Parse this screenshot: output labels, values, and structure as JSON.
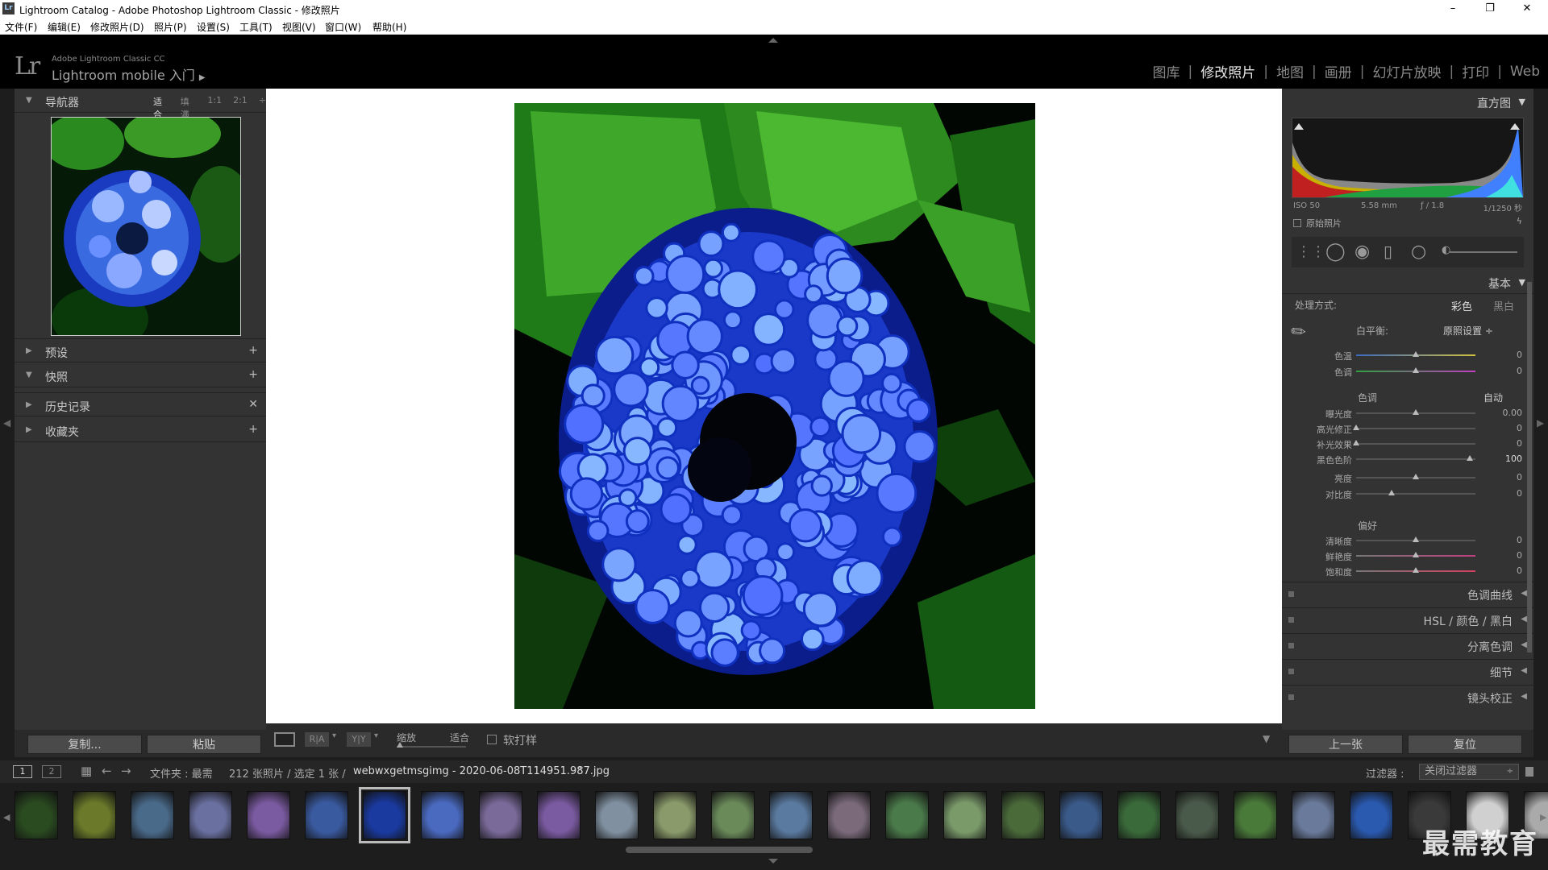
{
  "window": {
    "title": "Lightroom Catalog - Adobe Photoshop Lightroom Classic - 修改照片",
    "logo": "Lr",
    "minimize": "–",
    "maximize": "❐",
    "close": "✕"
  },
  "menu": [
    "文件(F)",
    "编辑(E)",
    "修改照片(D)",
    "照片(P)",
    "设置(S)",
    "工具(T)",
    "视图(V)",
    "窗口(W)",
    "帮助(H)"
  ],
  "brand": {
    "logo": "Lr",
    "line1": "Adobe Lightroom Classic CC",
    "line2": "Lightroom mobile 入门"
  },
  "modules": [
    {
      "label": "图库",
      "active": false
    },
    {
      "label": "修改照片",
      "active": true
    },
    {
      "label": "地图",
      "active": false
    },
    {
      "label": "画册",
      "active": false
    },
    {
      "label": "幻灯片放映",
      "active": false
    },
    {
      "label": "打印",
      "active": false
    },
    {
      "label": "Web",
      "active": false
    }
  ],
  "left": {
    "navigator": {
      "label": "导航器",
      "options": [
        "适合",
        "填满",
        "1:1",
        "2:1"
      ]
    },
    "panels": [
      {
        "label": "预设",
        "action": "+"
      },
      {
        "label": "快照",
        "action": "+"
      },
      {
        "label": "历史记录",
        "action": "✕"
      },
      {
        "label": "收藏夹",
        "action": "+"
      }
    ],
    "copy_btn": "复制...",
    "paste_btn": "粘贴"
  },
  "toolbar": {
    "zoom_label": "缩放",
    "zoom_value": "适合",
    "softproof": "软打样",
    "compare_ry": "R|A",
    "compare_yy": "Y|Y"
  },
  "right": {
    "histogram_label": "直方图",
    "exif": {
      "iso": "ISO 50",
      "focal": "5.58 mm",
      "aperture": "ƒ / 1.8",
      "shutter": "1/1250 秒"
    },
    "original_photo": "原始照片",
    "basic_label": "基本",
    "treatment_label": "处理方式:",
    "treatment_color": "彩色",
    "treatment_bw": "黑白",
    "wb_label": "白平衡:",
    "wb_value": "原照设置 ÷",
    "tone_label": "色调",
    "auto_label": "自动",
    "presence_label": "偏好",
    "sliders_wb": [
      {
        "name": "色温",
        "value": "0",
        "pos": 0.5
      },
      {
        "name": "色调",
        "value": "0",
        "pos": 0.5
      }
    ],
    "sliders_tone": [
      {
        "name": "曝光度",
        "value": "0.00",
        "pos": 0.5
      },
      {
        "name": "高光修正",
        "value": "0",
        "pos": 0.0
      },
      {
        "name": "补光效果",
        "value": "0",
        "pos": 0.0
      },
      {
        "name": "黑色色阶",
        "value": "100",
        "pos": 0.95
      }
    ],
    "sliders_tone2": [
      {
        "name": "亮度",
        "value": "0",
        "pos": 0.5
      },
      {
        "name": "对比度",
        "value": "0",
        "pos": 0.3
      }
    ],
    "sliders_presence": [
      {
        "name": "清晰度",
        "value": "0",
        "pos": 0.5
      },
      {
        "name": "鲜艳度",
        "value": "0",
        "pos": 0.5
      },
      {
        "name": "饱和度",
        "value": "0",
        "pos": 0.5
      }
    ],
    "sections": [
      "色调曲线",
      "HSL / 颜色 / 黑白",
      "分离色调",
      "细节",
      "镜头校正"
    ],
    "prev_btn": "上一张",
    "reset_btn": "复位"
  },
  "filmstrip": {
    "view1": "1",
    "view2": "2",
    "source": "文件夹 : 最需",
    "count": "212 张照片 / 选定 1 张 /",
    "filename": "webwxgetmsgimg - 2020-06-08T114951.987.jpg",
    "filter_label": "过滤器 :",
    "filter_value": "关闭过滤器",
    "selected_index": 6,
    "thumb_colors": [
      "#2a4a20",
      "#6a7a2a",
      "#4a6a8a",
      "#6a70a0",
      "#7a5aa0",
      "#3a5aa0",
      "#1a3aa0",
      "#4a6ac0",
      "#7a6a9a",
      "#7a5aa0",
      "#8090a0",
      "#8a9a6a",
      "#6a8a5a",
      "#5a7aa0",
      "#7a6a7a",
      "#4a7a4a",
      "#7a9a6a",
      "#4a6a3a",
      "#3a5a8a",
      "#3a6a3a",
      "#4a5a4a",
      "#4a7a3a",
      "#6a7a9a",
      "#2a5ab0",
      "#3a3a3a",
      "#d0d0d0",
      "#aaaaaa"
    ]
  },
  "watermark": "最需教育"
}
